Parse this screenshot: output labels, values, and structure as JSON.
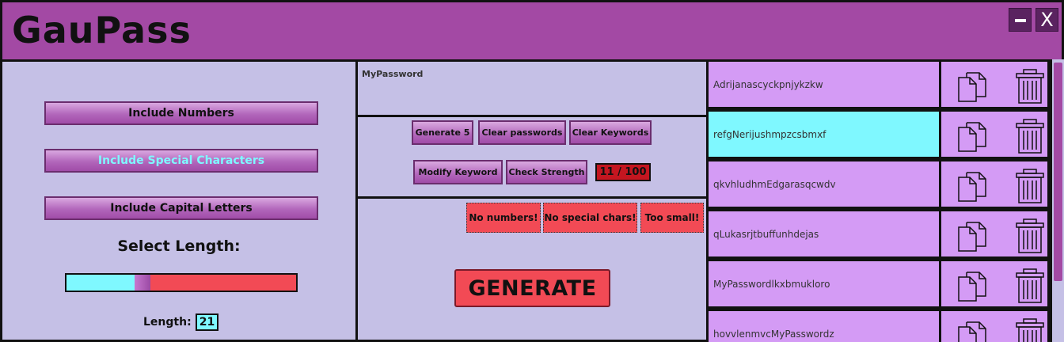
{
  "app": {
    "title": "GauPass",
    "minimize_label": "",
    "close_label": "X"
  },
  "options": {
    "include_numbers": "Include Numbers",
    "include_special": "Include Special Characters",
    "include_capitals": "Include Capital Letters",
    "special_enabled": true,
    "select_length_label": "Select Length:",
    "length_label": "Length:",
    "length_value": "21",
    "length_slider_fraction": 0.32
  },
  "password_field": {
    "value": "MyPassword"
  },
  "controls": {
    "generate5": "Generate 5",
    "clear_passwords": "Clear passwords",
    "clear_keywords": "Clear Keywords",
    "modify_keyword": "Modify Keyword",
    "check_strength": "Check Strength",
    "strength_value": "11 / 100"
  },
  "warnings": [
    "No numbers!",
    "No special chars!",
    "Too small!"
  ],
  "generate_label": "GENERATE",
  "passwords": [
    {
      "text": "Adrijanascyckpnjykzkw",
      "selected": false
    },
    {
      "text": "refgNerijushmpzcsbmxf",
      "selected": true
    },
    {
      "text": "qkvhludhmEdgarasqcwdv",
      "selected": false
    },
    {
      "text": "qLukasrjtbuffunhdejas",
      "selected": false
    },
    {
      "text": "MyPasswordlkxbmukloro",
      "selected": false
    },
    {
      "text": "hovvlenmvcMyPasswordz",
      "selected": false
    }
  ],
  "colors": {
    "accent": "#a349a4",
    "panel": "#c5c0e6",
    "list_item": "#d49bf5",
    "selected": "#7ff8ff",
    "warning": "#f24a55"
  }
}
